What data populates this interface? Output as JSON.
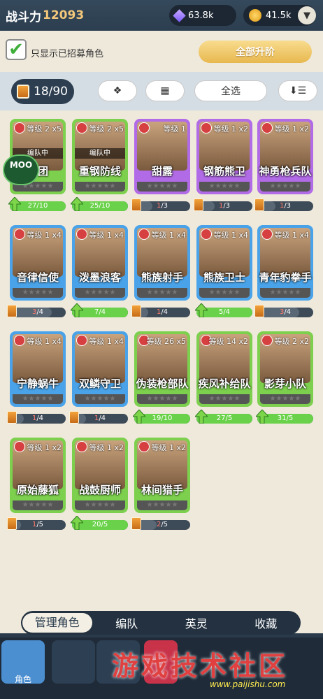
{
  "header": {
    "power_label": "战斗力",
    "power_value": "12093",
    "gems": "63.8k",
    "coins": "41.5k",
    "dropdown_icon": "chevron-down-icon"
  },
  "filter": {
    "checkbox_label": "只显示已招募角色",
    "checked": true,
    "upgrade_all": "全部升阶"
  },
  "toolbar": {
    "count": "18/90",
    "select_all": "全选",
    "icons": [
      "paw-icon",
      "grid-icon",
      "sort-icon"
    ]
  },
  "cards": [
    {
      "name": "狮团",
      "level": "等级 2",
      "count": "x5",
      "team": "编队中",
      "frame": "green",
      "progress": "27/10",
      "fill": 1.0
    },
    {
      "name": "重钢防线",
      "level": "等级 2",
      "count": "x5",
      "team": "编队中",
      "frame": "green",
      "progress": "25/10",
      "fill": 1.0
    },
    {
      "name": "甜露",
      "level": "等级 1",
      "count": "",
      "team": "",
      "frame": "purple",
      "progress": "1/3",
      "fill": 0.33
    },
    {
      "name": "钢筋熊卫",
      "level": "等级 1",
      "count": "x2",
      "team": "",
      "frame": "purple",
      "progress": "1/3",
      "fill": 0.33
    },
    {
      "name": "神勇枪兵队",
      "level": "等级 1",
      "count": "x2",
      "team": "",
      "frame": "purple",
      "progress": "1/3",
      "fill": 0.33
    },
    {
      "name": "音律信使",
      "level": "等级 1",
      "count": "x4",
      "team": "",
      "frame": "blue",
      "progress": "3/4",
      "fill": 0.75
    },
    {
      "name": "泼墨浪客",
      "level": "等级 1",
      "count": "x4",
      "team": "",
      "frame": "blue",
      "progress": "7/4",
      "fill": 1.0
    },
    {
      "name": "熊族射手",
      "level": "等级 1",
      "count": "x4",
      "team": "",
      "frame": "blue",
      "progress": "1/4",
      "fill": 0.25
    },
    {
      "name": "熊族卫士",
      "level": "等级 1",
      "count": "x4",
      "team": "",
      "frame": "blue",
      "progress": "5/4",
      "fill": 1.0
    },
    {
      "name": "青年豹拳手",
      "level": "等级 1",
      "count": "x4",
      "team": "",
      "frame": "blue",
      "progress": "3/4",
      "fill": 0.75
    },
    {
      "name": "宁静蜗牛",
      "level": "等级 1",
      "count": "x4",
      "team": "",
      "frame": "blue",
      "progress": "1/4",
      "fill": 0.25
    },
    {
      "name": "双鳞守卫",
      "level": "等级 1",
      "count": "x4",
      "team": "",
      "frame": "blue",
      "progress": "1/4",
      "fill": 0.25
    },
    {
      "name": "伪装枪部队",
      "level": "等级 26",
      "count": "x5",
      "team": "",
      "frame": "green",
      "progress": "19/10",
      "fill": 1.0
    },
    {
      "name": "疾风补给队",
      "level": "等级 14",
      "count": "x2",
      "team": "",
      "frame": "green",
      "progress": "27/5",
      "fill": 1.0
    },
    {
      "name": "影芽小队",
      "level": "等级 2",
      "count": "x2",
      "team": "",
      "frame": "green",
      "progress": "31/5",
      "fill": 1.0
    },
    {
      "name": "原始藤狐",
      "level": "等级 1",
      "count": "x2",
      "team": "",
      "frame": "green",
      "progress": "1/5",
      "fill": 0.2
    },
    {
      "name": "战鼓厨师",
      "level": "等级 1",
      "count": "x2",
      "team": "",
      "frame": "green",
      "progress": "20/5",
      "fill": 1.0
    },
    {
      "name": "林间猎手",
      "level": "等级 1",
      "count": "x2",
      "team": "",
      "frame": "green",
      "progress": "2/5",
      "fill": 0.4
    }
  ],
  "segments": [
    "管理角色",
    "编队",
    "英灵",
    "收藏"
  ],
  "bottom_nav": {
    "active_label": "角色"
  },
  "watermark": {
    "text": "游戏技术社区",
    "url": "www.paijishu.com",
    "badge": "MOO"
  }
}
